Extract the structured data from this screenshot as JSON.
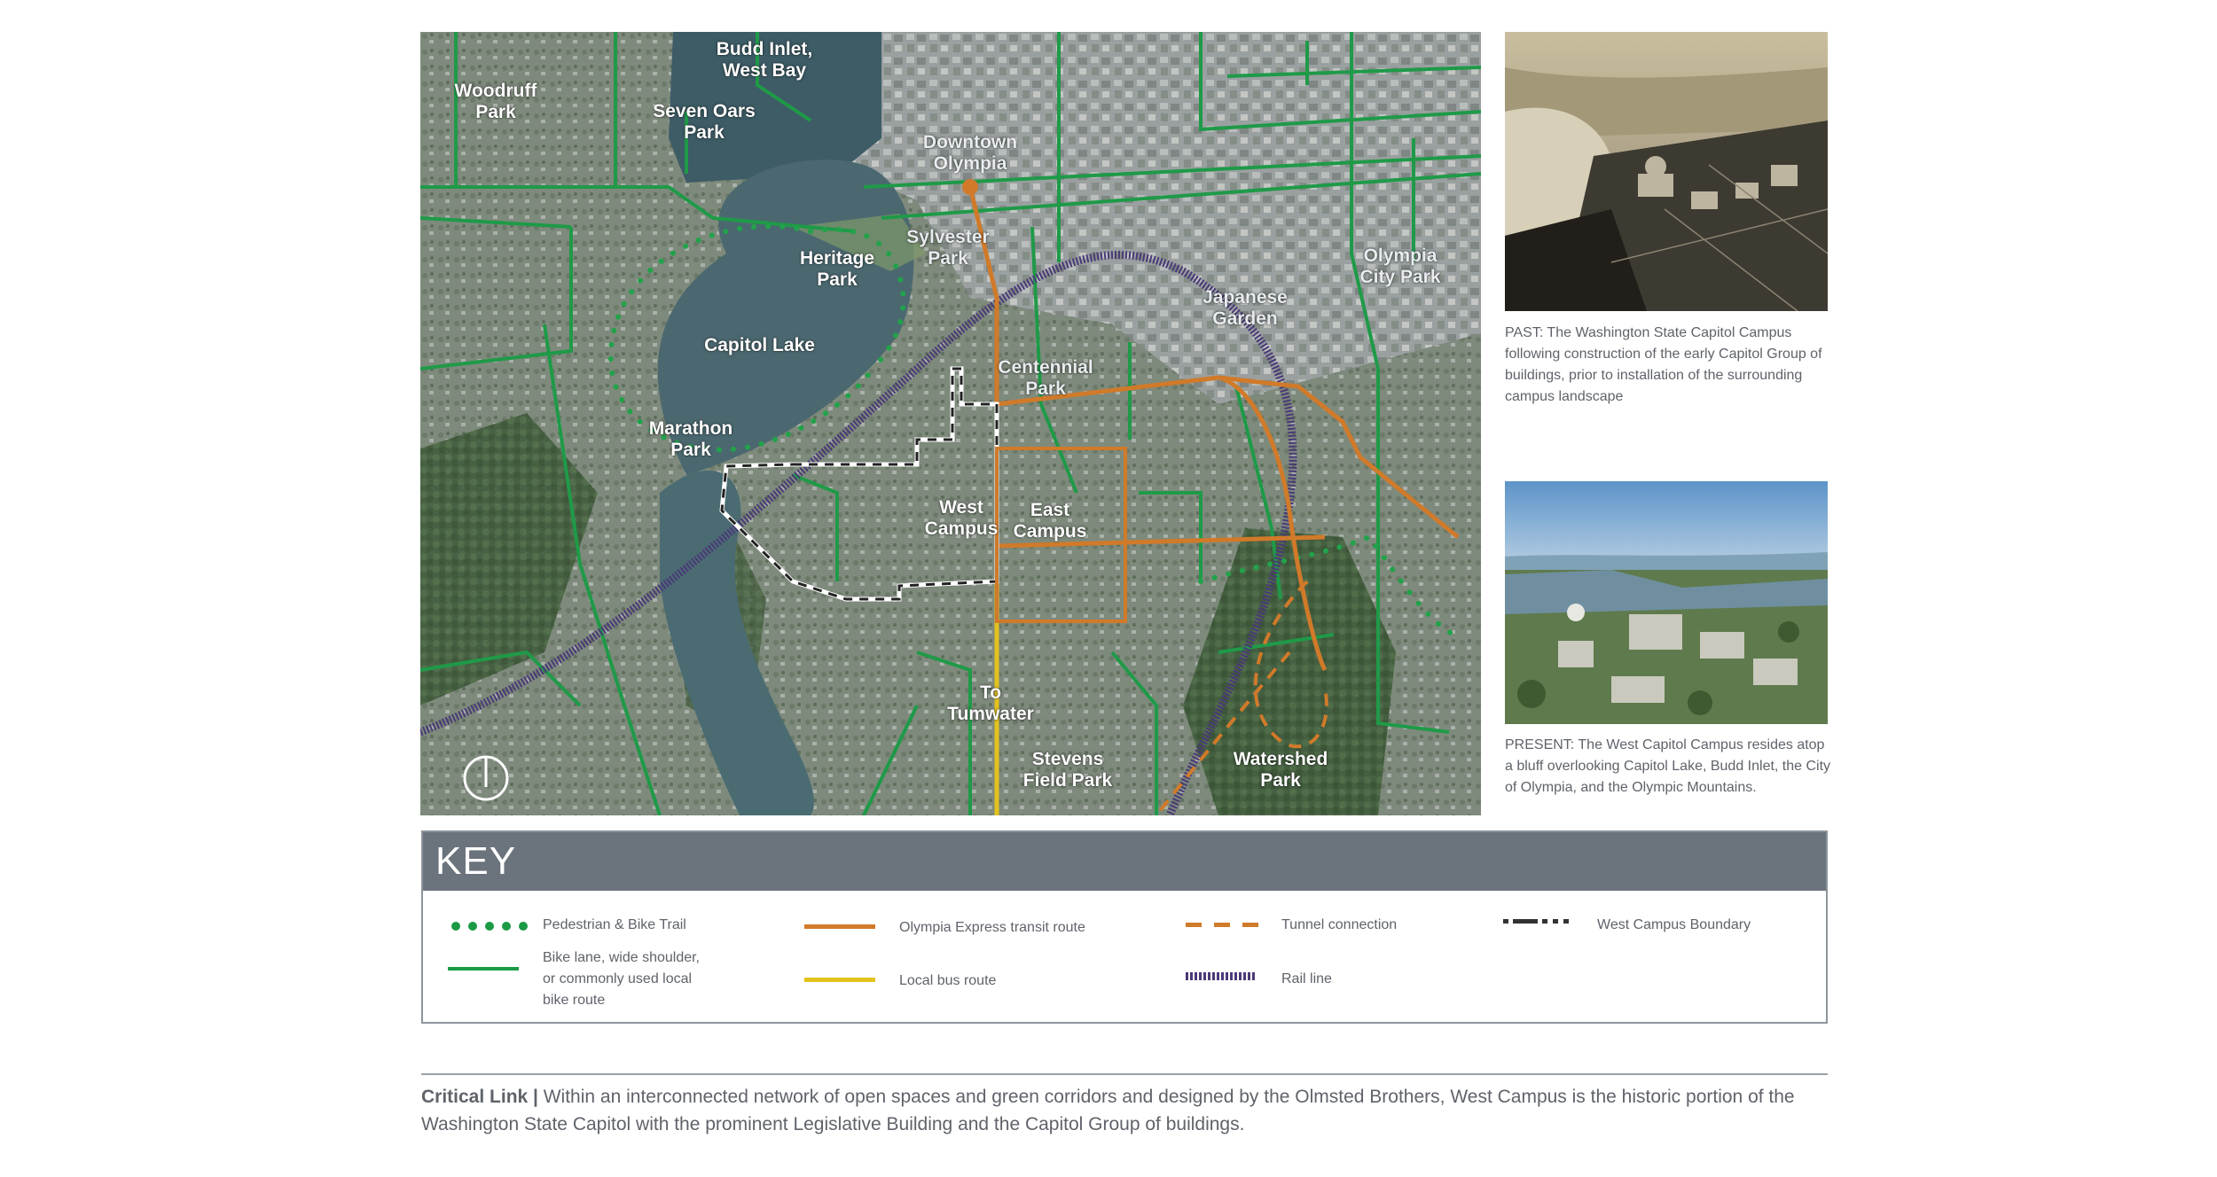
{
  "map": {
    "labels": {
      "budd_inlet": "Budd Inlet,\nWest Bay",
      "woodruff": "Woodruff\nPark",
      "seven_oars": "Seven Oars\nPark",
      "downtown": "Downtown\nOlympia",
      "sylvester": "Sylvester\nPark",
      "heritage": "Heritage\nPark",
      "capitol_lake": "Capitol Lake",
      "japanese_garden": "Japanese\nGarden",
      "olympia_city_park": "Olympia\nCity Park",
      "centennial": "Centennial\nPark",
      "marathon": "Marathon\nPark",
      "west_campus": "West\nCampus",
      "east_campus": "East\nCampus",
      "tumwater": "To\nTumwater",
      "stevens": "Stevens\nField Park",
      "watershed": "Watershed\nPark"
    },
    "north_icon": "north-arrow-icon",
    "colors": {
      "trail": "#1a9a45",
      "bike": "#1f9a48",
      "express": "#d07a2a",
      "local_bus": "#e3c21d",
      "rail": "#4a3a78",
      "boundary": "#ffffff"
    }
  },
  "photos": {
    "past_caption": "PAST: The Washington State Capitol Campus following construction of the early Capitol Group of buildings, prior to installation of the surrounding campus landscape",
    "present_caption": "PRESENT: The West Capitol Campus resides atop a bluff overlooking Capitol Lake, Budd Inlet, the City of Olympia, and the Olympic Mountains."
  },
  "key": {
    "title": "KEY",
    "items": {
      "trail": "Pedestrian & Bike Trail",
      "bike_lane": "Bike lane, wide shoulder,\nor commonly used local\nbike route",
      "express": "Olympia Express transit route",
      "local_bus": "Local bus route",
      "tunnel": "Tunnel connection",
      "rail": "Rail line",
      "boundary": "West Campus Boundary"
    }
  },
  "caption": {
    "lead": "Critical Link |",
    "text": " Within an interconnected network of open spaces and green corridors and designed by the Olmsted Brothers, West Campus is the historic portion of the Washington State Capitol with the prominent Legislative Building and the Capitol Group of buildings."
  }
}
